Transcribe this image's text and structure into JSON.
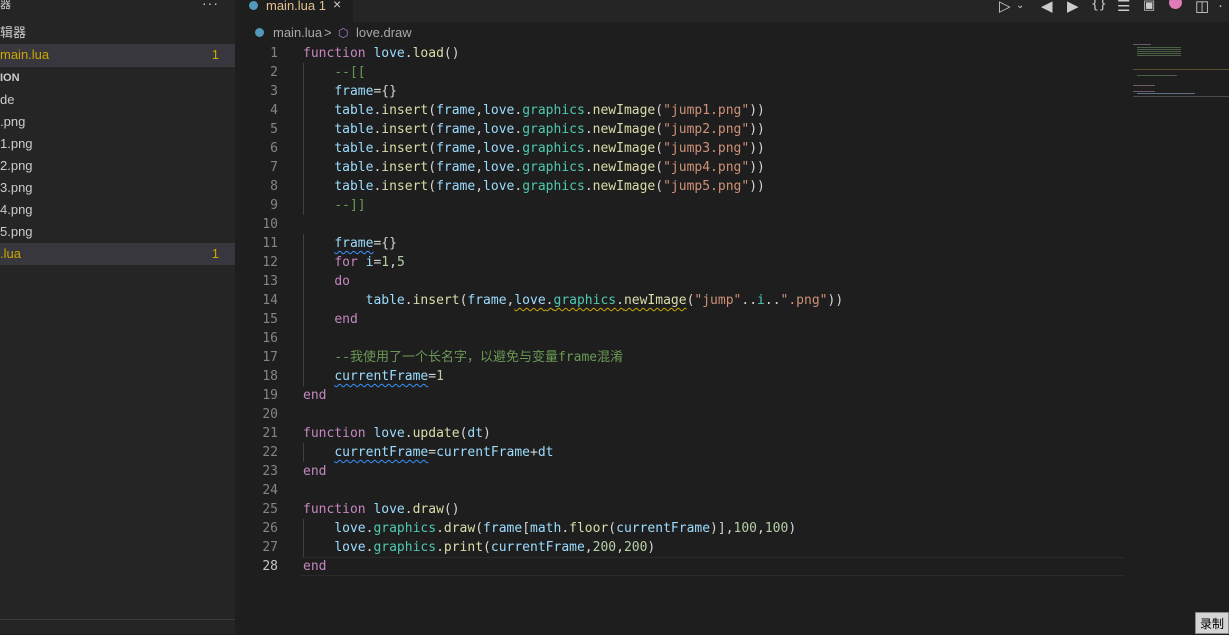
{
  "sidebar": {
    "header": "器",
    "more": "···",
    "open_editor_group": "辑器",
    "open_file": {
      "label": "main.lua",
      "badge": "1"
    },
    "section_title": "ION",
    "files": [
      {
        "label": "de",
        "badge": ""
      },
      {
        "label": ".png",
        "badge": ""
      },
      {
        "label": "1.png",
        "badge": ""
      },
      {
        "label": "2.png",
        "badge": ""
      },
      {
        "label": "3.png",
        "badge": ""
      },
      {
        "label": "4.png",
        "badge": ""
      },
      {
        "label": "5.png",
        "badge": ""
      },
      {
        "label": ".lua",
        "badge": "1"
      }
    ]
  },
  "tab": {
    "label": "main.lua 1",
    "close": "×"
  },
  "toolbar_icons": [
    "run-icon",
    "dropdown-icon",
    "back-icon",
    "forward-icon",
    "braces-icon",
    "list-icon",
    "terminal-icon",
    "heart-icon",
    "split-icon",
    "more-icon"
  ],
  "breadcrumb": {
    "file": "main.lua",
    "separator": ">",
    "symbol": "love.draw"
  },
  "editor": {
    "current_line": 28,
    "lines": [
      "function love.load()",
      "    --[[",
      "    frame={}",
      "    table.insert(frame,love.graphics.newImage(\"jump1.png\"))",
      "    table.insert(frame,love.graphics.newImage(\"jump2.png\"))",
      "    table.insert(frame,love.graphics.newImage(\"jump3.png\"))",
      "    table.insert(frame,love.graphics.newImage(\"jump4.png\"))",
      "    table.insert(frame,love.graphics.newImage(\"jump5.png\"))",
      "    --]]",
      "",
      "    frame={}",
      "    for i=1,5",
      "    do",
      "        table.insert(frame,love.graphics.newImage(\"jump\"..i..\".png\"))",
      "    end",
      "",
      "    --我使用了一个长名字，以避免与变量frame混淆",
      "    currentFrame=1",
      "end",
      "",
      "function love.update(dt)",
      "    currentFrame=currentFrame+dt",
      "end",
      "",
      "function love.draw()",
      "    love.graphics.draw(frame[math.floor(currentFrame)],100,100)",
      "    love.graphics.print(currentFrame,200,200)",
      "end"
    ]
  },
  "record_button": "录制"
}
